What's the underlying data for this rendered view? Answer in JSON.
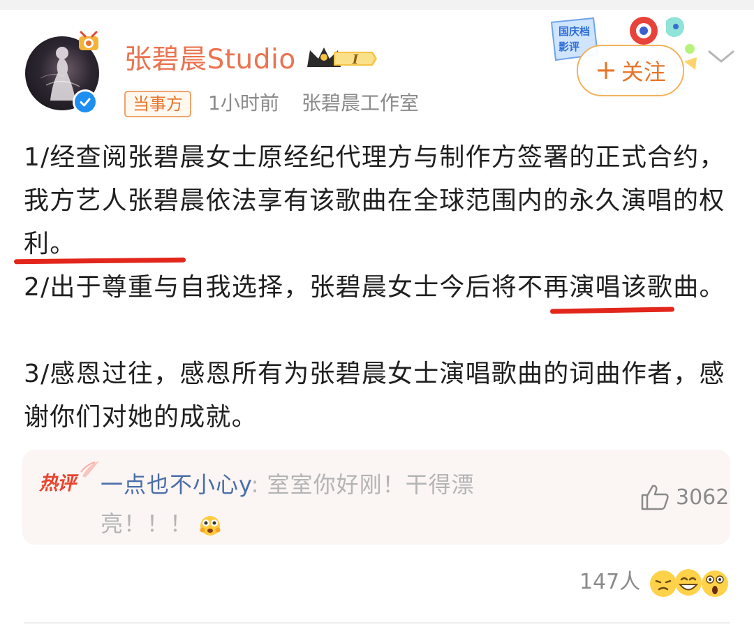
{
  "post": {
    "username": "张碧晨Studio",
    "level_badge": "I",
    "tag": "当事方",
    "time": "1小时前",
    "source": "张碧晨工作室",
    "follow_label": "关注",
    "decor_text": "国庆档 影评",
    "body": {
      "p1_a": "1/经查阅张碧晨女士原经纪代理方与制作方签署的正式合约，我方艺人张碧晨依法享有该歌曲在全球范围内的",
      "p1_b": "永久演唱的权",
      "p1_c": "利。",
      "p2_a": "2/出于尊重与自我选择，张碧晨女士今后将",
      "p2_b": "不再演唱",
      "p2_c": "该歌曲。",
      "p3": "3/感恩过往，感恩所有为张碧晨女士演唱歌曲的词曲作者，感谢你们对她的成就。"
    }
  },
  "hot_comment": {
    "tag": "热评",
    "user": "一点也不小心y",
    "separator": ": ",
    "text": "室室你好刚！干得漂亮！！！",
    "likes": "3062"
  },
  "reactions": {
    "count": "147人"
  },
  "colors": {
    "username": "#eb7350",
    "accent_orange": "#e8752b",
    "underline_red": "#e2261c",
    "comment_user": "#4a6ea8",
    "meta_gray": "#8a8a8a"
  },
  "icons": [
    "avatar-pendant-icon",
    "verified-icon",
    "crown-badge-icon",
    "plus-icon",
    "chevron-down-icon",
    "thumbs-up-icon",
    "hot-wing-icon",
    "emoji-face-icon"
  ]
}
